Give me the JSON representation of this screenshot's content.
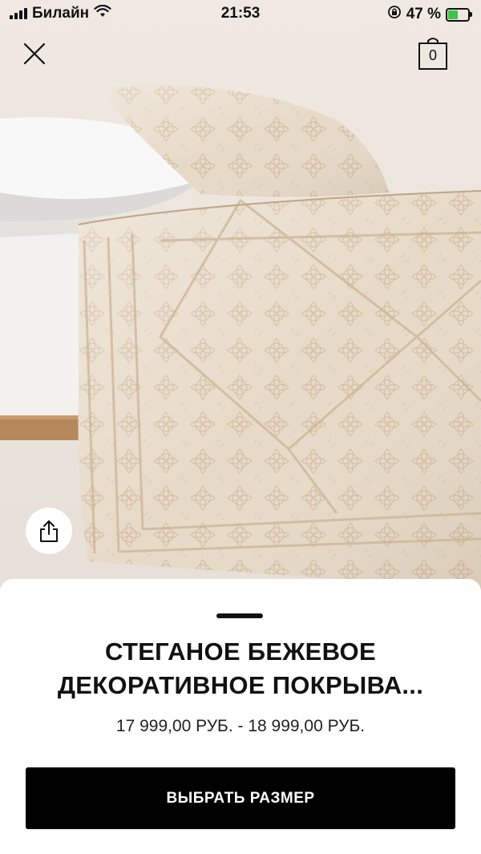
{
  "status_bar": {
    "carrier": "Билайн",
    "time": "21:53",
    "battery_percent": "47 %",
    "battery_level": 0.47,
    "battery_color": "#3fc34b"
  },
  "header": {
    "close_icon": "close-icon",
    "cart_count": "0"
  },
  "product": {
    "title_line1": "СТЕГАНОЕ БЕЖЕВОЕ",
    "title_line2": "ДЕКОРАТИВНОЕ ПОКРЫВА...",
    "price": "17 999,00  РУБ. - 18 999,00  РУБ.",
    "cta_label": "ВЫБРАТЬ РАЗМЕР"
  },
  "colors": {
    "accent": "#000000",
    "bedspread": "#e4d6c3"
  }
}
